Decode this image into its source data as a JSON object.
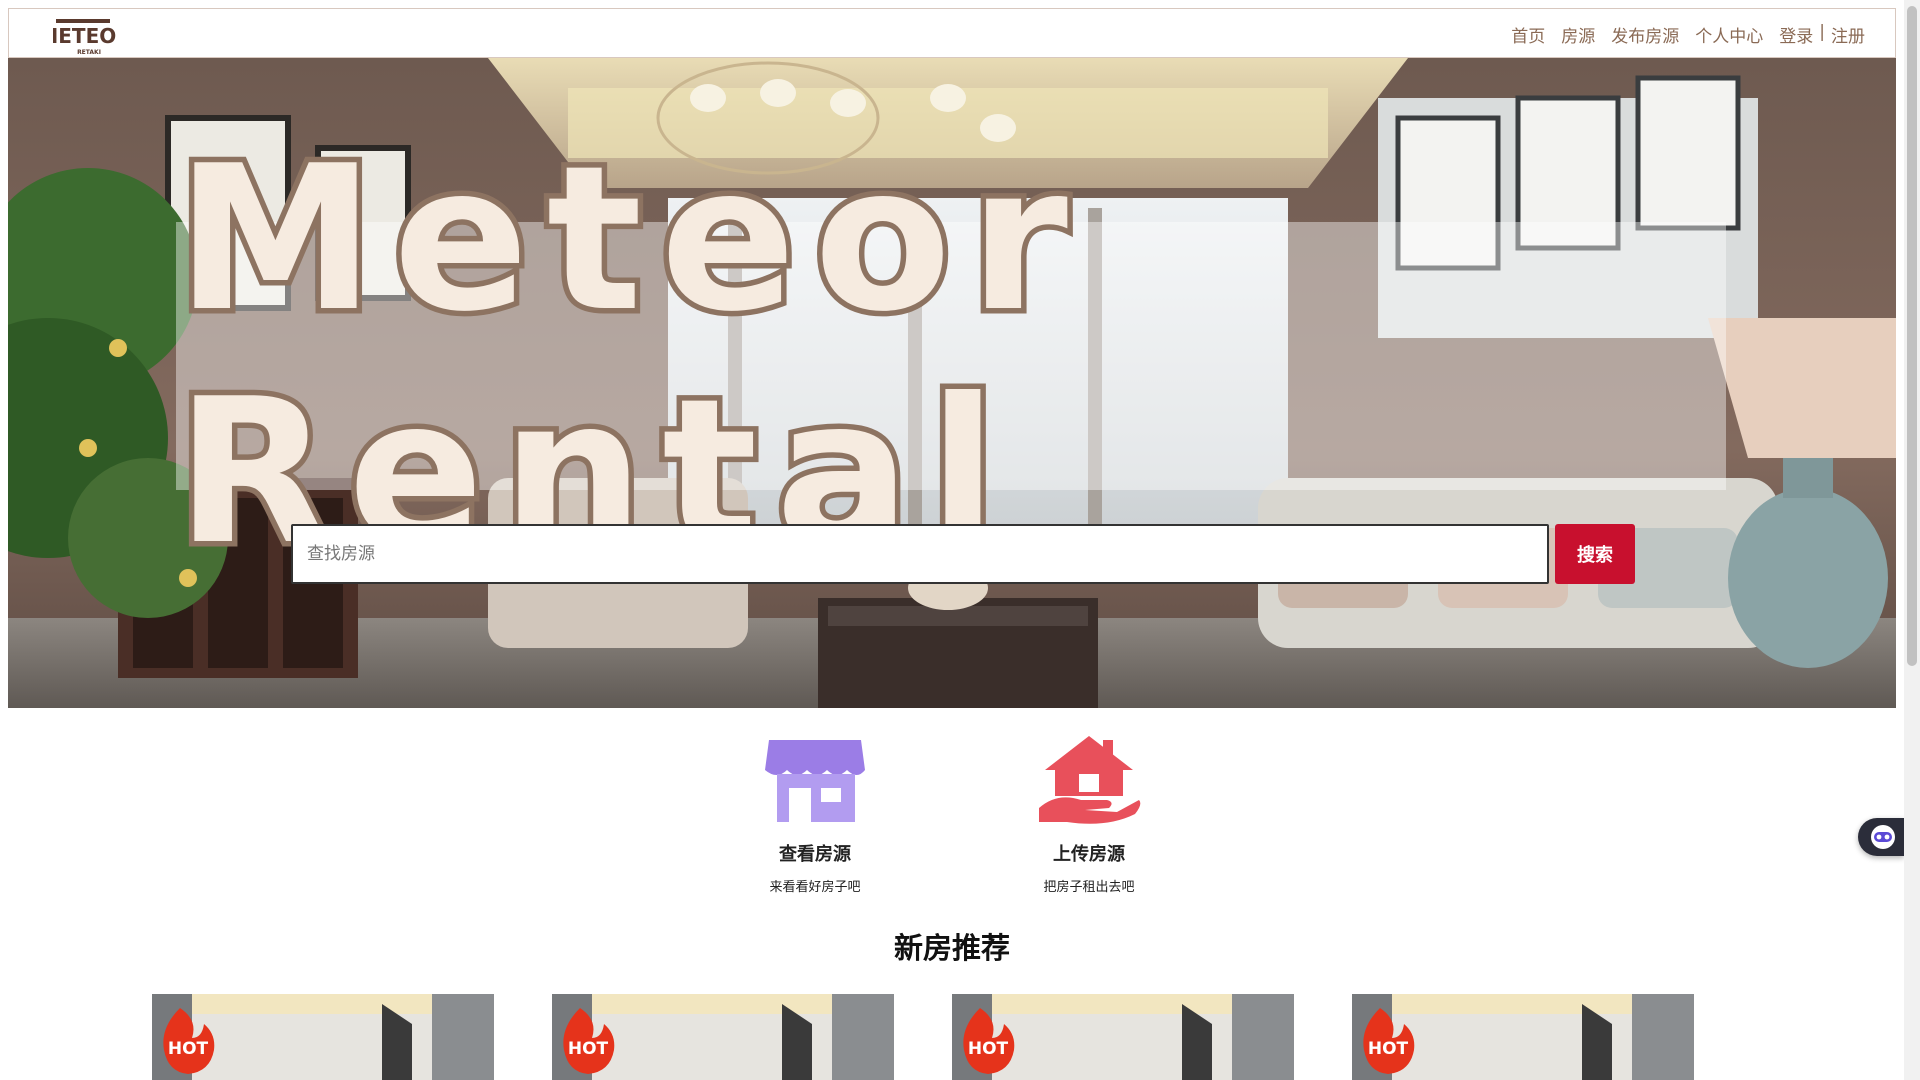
{
  "nav": {
    "logo_text": "METEOR",
    "logo_subtext": "RETAKI",
    "links": [
      "首页",
      "房源",
      "发布房源",
      "个人中心"
    ],
    "login": "登录",
    "separator": "|",
    "register": "注册"
  },
  "hero": {
    "title": "Meteor Rental",
    "search_placeholder": "查找房源",
    "search_value": "",
    "search_button": "搜索"
  },
  "features": [
    {
      "title": "查看房源",
      "subtitle": "来看看好房子吧",
      "icon": "storefront-icon"
    },
    {
      "title": "上传房源",
      "subtitle": "把房子租出去吧",
      "icon": "house-hand-icon"
    }
  ],
  "section_title": "新房推荐",
  "cards": [
    {
      "badge": "HOT"
    },
    {
      "badge": "HOT"
    },
    {
      "badge": "HOT"
    },
    {
      "badge": "HOT"
    }
  ],
  "colors": {
    "accent": "#c8102e",
    "nav_text": "#8a6a55",
    "title_fill": "#f6ebe0",
    "title_stroke": "#8d7361",
    "store_icon": "#a78be8",
    "house_icon": "#e8505b"
  }
}
